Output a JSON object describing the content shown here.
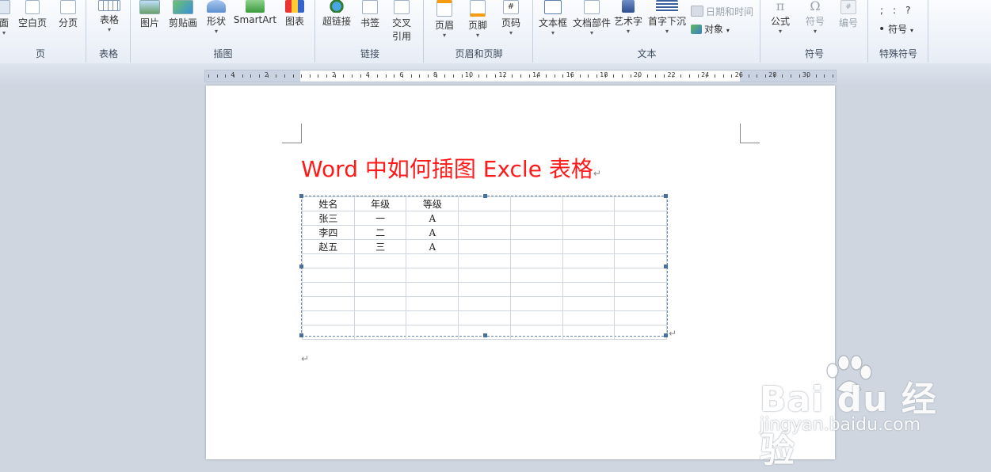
{
  "ribbon": {
    "groups": [
      {
        "label": "页",
        "buttons": [
          {
            "label": "面"
          },
          {
            "label": "空白页"
          },
          {
            "label": "分页"
          }
        ]
      },
      {
        "label": "表格",
        "buttons": [
          {
            "label": "表格"
          }
        ]
      },
      {
        "label": "插图",
        "buttons": [
          {
            "label": "图片"
          },
          {
            "label": "剪贴画"
          },
          {
            "label": "形状"
          },
          {
            "label": "SmartArt"
          },
          {
            "label": "图表"
          }
        ]
      },
      {
        "label": "链接",
        "buttons": [
          {
            "label": "超链接"
          },
          {
            "label": "书签"
          },
          {
            "label": "交叉引用"
          }
        ]
      },
      {
        "label": "页眉和页脚",
        "buttons": [
          {
            "label": "页眉"
          },
          {
            "label": "页脚"
          },
          {
            "label": "页码"
          }
        ]
      },
      {
        "label": "文本",
        "buttons": [
          {
            "label": "文本框"
          },
          {
            "label": "文档部件"
          },
          {
            "label": "艺术字"
          },
          {
            "label": "首字下沉"
          }
        ],
        "small": [
          {
            "label": "日期和时间"
          },
          {
            "label": "对象"
          }
        ]
      },
      {
        "label": "符号",
        "buttons": [
          {
            "label": "公式"
          },
          {
            "label": "符号"
          },
          {
            "label": "编号"
          }
        ]
      },
      {
        "label": "特殊符号",
        "symbols": [
          ";",
          ":",
          "?"
        ],
        "small": [
          {
            "label": "符号"
          }
        ]
      }
    ],
    "cross_ref_line2": "引用",
    "icon_glyphs": {
      "pi": "π",
      "omega": "Ω",
      "hash": "#"
    }
  },
  "ruler": {
    "numbers": [
      "4",
      "2",
      "2",
      "4",
      "6",
      "8",
      "10",
      "12",
      "14",
      "16",
      "18",
      "20",
      "22",
      "24",
      "26",
      "28",
      "30"
    ]
  },
  "document": {
    "title": "Word 中如何插图 Excle 表格",
    "para_mark": "↵",
    "sheet": {
      "rows": [
        [
          "姓名",
          "年级",
          "等级",
          "",
          "",
          "",
          ""
        ],
        [
          "张三",
          "一",
          "A",
          "",
          "",
          "",
          ""
        ],
        [
          "李四",
          "二",
          "A",
          "",
          "",
          "",
          ""
        ],
        [
          "赵五",
          "三",
          "A",
          "",
          "",
          "",
          ""
        ],
        [
          "",
          "",
          "",
          "",
          "",
          "",
          ""
        ],
        [
          "",
          "",
          "",
          "",
          "",
          "",
          ""
        ],
        [
          "",
          "",
          "",
          "",
          "",
          "",
          ""
        ],
        [
          "",
          "",
          "",
          "",
          "",
          "",
          ""
        ],
        [
          "",
          "",
          "",
          "",
          "",
          "",
          ""
        ],
        [
          "",
          "",
          "",
          "",
          "",
          "",
          ""
        ]
      ]
    }
  },
  "watermark": {
    "logo_text": "Bai du 经验",
    "url": "jingyan.baidu.com"
  },
  "colors": {
    "title": "#ff1a1a",
    "ribbon_bg": "#e7edf6",
    "workspace_bg": "#cfd6e0",
    "handle": "#48709f"
  }
}
